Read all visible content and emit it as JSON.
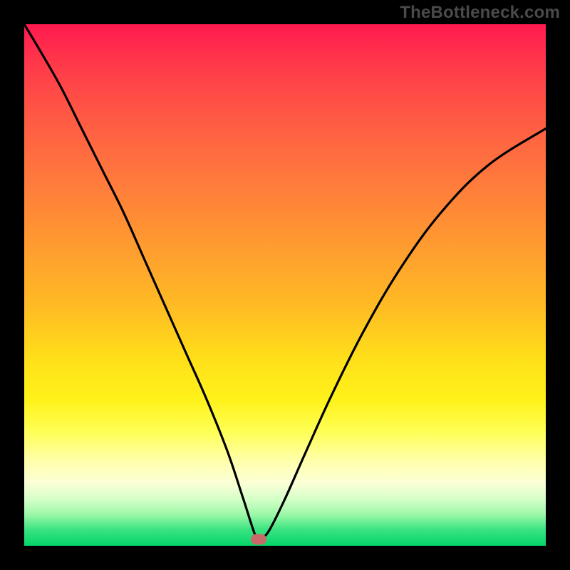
{
  "watermark": "TheBottleneck.com",
  "colors": {
    "frame": "#000000",
    "curve": "#000000",
    "marker": "#c96a6a",
    "gradient_top": "#ff1a4f",
    "gradient_bottom": "#04d56a"
  },
  "chart_data": {
    "type": "line",
    "title": "",
    "xlabel": "",
    "ylabel": "",
    "xlim": [
      0,
      1
    ],
    "ylim": [
      0,
      1
    ],
    "note": "Axes are unlabeled; values are normalized fractions of the gradient plot area. y=1 is top (red), y=0 is bottom (green). The curve is a V/funnel shape with minimum near x≈0.45.",
    "series": [
      {
        "name": "bottleneck-curve",
        "x": [
          0.0,
          0.03,
          0.07,
          0.11,
          0.15,
          0.19,
          0.23,
          0.27,
          0.31,
          0.35,
          0.39,
          0.42,
          0.445,
          0.455,
          0.47,
          0.5,
          0.54,
          0.59,
          0.65,
          0.72,
          0.8,
          0.89,
          1.0
        ],
        "y": [
          1.0,
          0.95,
          0.88,
          0.8,
          0.72,
          0.64,
          0.55,
          0.46,
          0.37,
          0.28,
          0.18,
          0.09,
          0.015,
          0.015,
          0.03,
          0.09,
          0.18,
          0.29,
          0.41,
          0.53,
          0.64,
          0.73,
          0.8
        ]
      }
    ],
    "marker": {
      "x": 0.45,
      "y": 0.012,
      "label": "optimal-point"
    }
  }
}
